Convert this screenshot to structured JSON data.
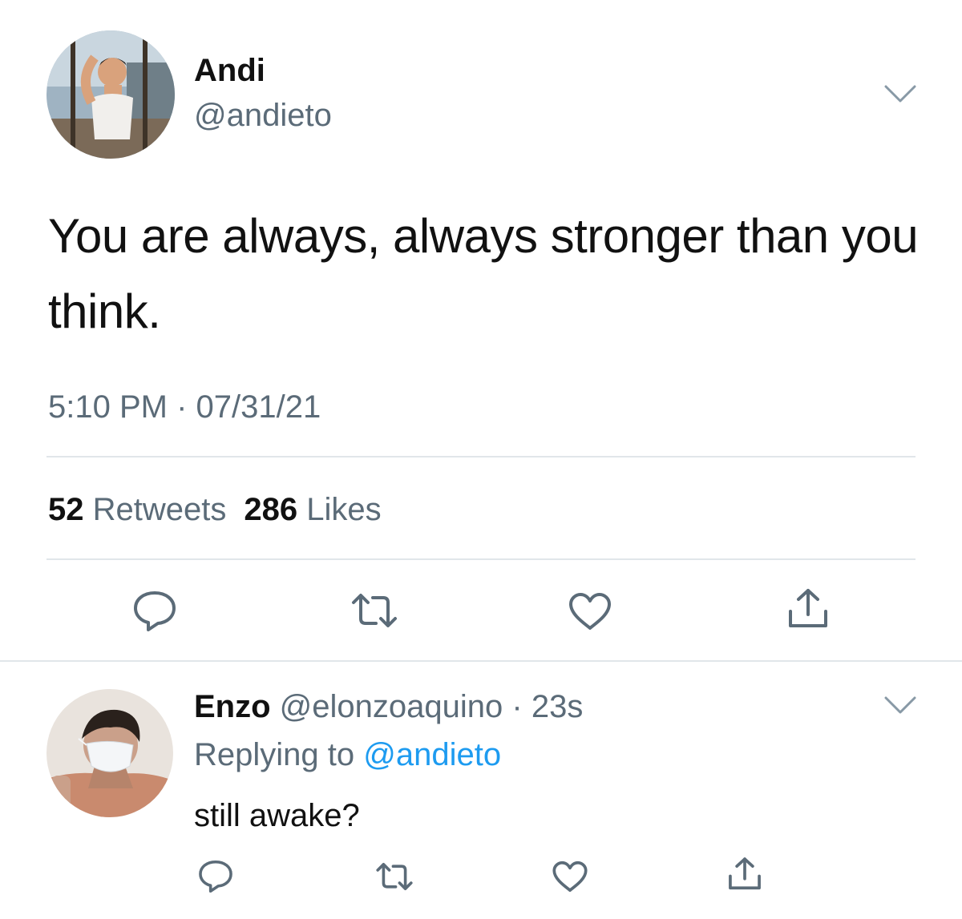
{
  "tweet": {
    "author_name": "Andi",
    "author_handle": "@andieto",
    "text": "You are always, always stronger than you think.",
    "time": "5:10 PM",
    "date": "07/31/21",
    "separator": "·",
    "retweet_count": "52",
    "retweet_label": "Retweets",
    "like_count": "286",
    "like_label": "Likes"
  },
  "reply": {
    "author_name": "Enzo",
    "author_handle": "@elonzoaquino",
    "separator": "·",
    "age": "23s",
    "replying_prefix": "Replying to",
    "replying_handle": "@andieto",
    "text": "still awake?"
  },
  "icons": {
    "more": "chevron-down-icon",
    "reply": "comment-icon",
    "retweet": "retweet-icon",
    "like": "heart-icon",
    "share": "share-icon"
  },
  "colors": {
    "secondary_text": "#5b6b78",
    "link": "#1d9bf0",
    "divider": "#e1e6ea",
    "icon": "#5b6b78"
  }
}
